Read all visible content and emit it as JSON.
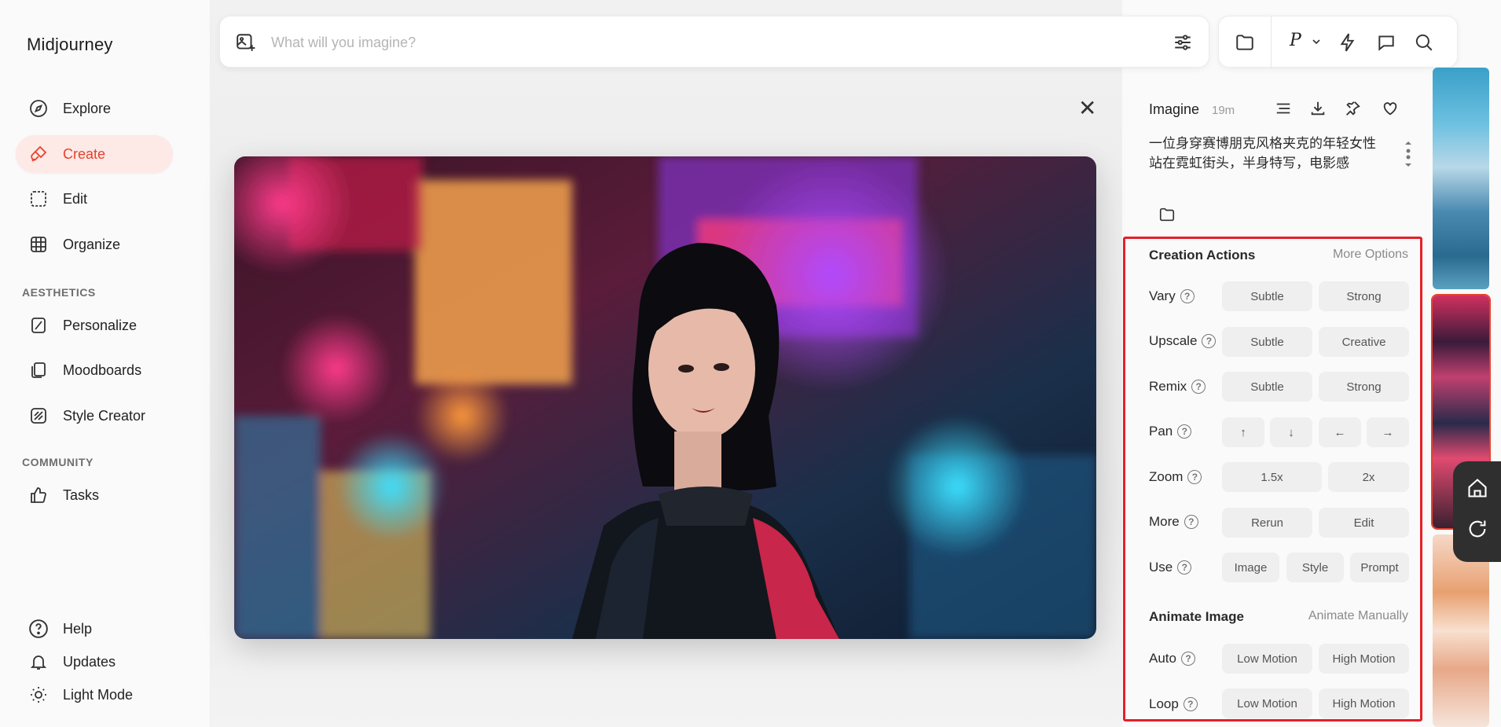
{
  "app": {
    "title": "Midjourney"
  },
  "sidebar": {
    "items": [
      {
        "label": "Explore",
        "icon": "compass-icon"
      },
      {
        "label": "Create",
        "icon": "brush-icon",
        "active": true
      },
      {
        "label": "Edit",
        "icon": "edit-frame-icon"
      },
      {
        "label": "Organize",
        "icon": "grid-icon"
      }
    ],
    "aesthetics_heading": "AESTHETICS",
    "aesthetics_items": [
      {
        "label": "Personalize",
        "icon": "personalize-icon"
      },
      {
        "label": "Moodboards",
        "icon": "moodboard-icon"
      },
      {
        "label": "Style Creator",
        "icon": "style-creator-icon"
      }
    ],
    "community_heading": "COMMUNITY",
    "community_items": [
      {
        "label": "Tasks",
        "icon": "thumbs-up-icon"
      }
    ],
    "footer_items": [
      {
        "label": "Help",
        "icon": "help-icon"
      },
      {
        "label": "Updates",
        "icon": "bell-icon"
      },
      {
        "label": "Light Mode",
        "icon": "sun-icon"
      }
    ]
  },
  "search": {
    "placeholder": "What will you imagine?",
    "value": ""
  },
  "toolbar": {
    "profile_letter": "P"
  },
  "details": {
    "title": "Imagine",
    "time": "19m",
    "prompt": "一位身穿赛博朋克风格夹克的年轻女性站在霓虹街头，半身特写，电影感"
  },
  "creation_actions": {
    "title": "Creation Actions",
    "more_link": "More Options",
    "rows": [
      {
        "label": "Vary",
        "buttons": [
          "Subtle",
          "Strong"
        ]
      },
      {
        "label": "Upscale",
        "buttons": [
          "Subtle",
          "Creative"
        ]
      },
      {
        "label": "Remix",
        "buttons": [
          "Subtle",
          "Strong"
        ]
      },
      {
        "label": "Pan",
        "buttons": [
          "↑",
          "↓",
          "←",
          "→"
        ]
      },
      {
        "label": "Zoom",
        "buttons": [
          "1.5x",
          "2x"
        ]
      },
      {
        "label": "More",
        "buttons": [
          "Rerun",
          "Edit"
        ]
      },
      {
        "label": "Use",
        "buttons": [
          "Image",
          "Style",
          "Prompt"
        ]
      }
    ]
  },
  "animate": {
    "title": "Animate Image",
    "manual_link": "Animate Manually",
    "rows": [
      {
        "label": "Auto",
        "buttons": [
          "Low Motion",
          "High Motion"
        ]
      },
      {
        "label": "Loop",
        "buttons": [
          "Low Motion",
          "High Motion"
        ]
      }
    ]
  },
  "colors": {
    "accent": "#e8412c",
    "highlight": "#e5202a"
  }
}
